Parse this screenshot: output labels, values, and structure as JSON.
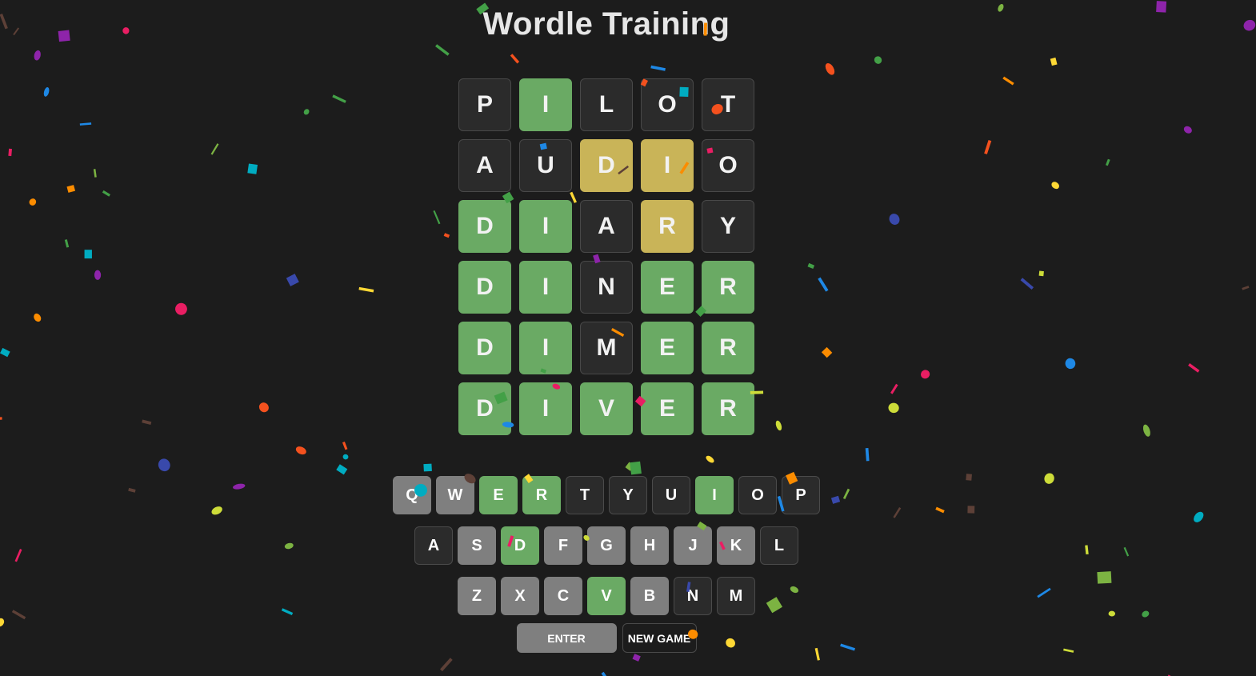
{
  "app": {
    "title": "Wordle Training"
  },
  "colors": {
    "background": "#1c1c1c",
    "correct": "#6aaa64",
    "present": "#c9b458",
    "absent_tile": "#2b2b2b",
    "used_key": "#7f7f7f",
    "unused_key": "#2b2b2b"
  },
  "board": {
    "rows": [
      {
        "letters": [
          "P",
          "I",
          "L",
          "O",
          "T"
        ],
        "states": [
          "absent",
          "correct",
          "absent",
          "absent",
          "absent"
        ]
      },
      {
        "letters": [
          "A",
          "U",
          "D",
          "I",
          "O"
        ],
        "states": [
          "absent",
          "absent",
          "present",
          "present",
          "absent"
        ]
      },
      {
        "letters": [
          "D",
          "I",
          "A",
          "R",
          "Y"
        ],
        "states": [
          "correct",
          "correct",
          "absent",
          "present",
          "absent"
        ]
      },
      {
        "letters": [
          "D",
          "I",
          "N",
          "E",
          "R"
        ],
        "states": [
          "correct",
          "correct",
          "absent",
          "correct",
          "correct"
        ]
      },
      {
        "letters": [
          "D",
          "I",
          "M",
          "E",
          "R"
        ],
        "states": [
          "correct",
          "correct",
          "absent",
          "correct",
          "correct"
        ]
      },
      {
        "letters": [
          "D",
          "I",
          "V",
          "E",
          "R"
        ],
        "states": [
          "correct",
          "correct",
          "correct",
          "correct",
          "correct"
        ]
      }
    ]
  },
  "keyboard": {
    "rows": [
      [
        {
          "key": "Q",
          "state": "used"
        },
        {
          "key": "W",
          "state": "used"
        },
        {
          "key": "E",
          "state": "correct"
        },
        {
          "key": "R",
          "state": "correct"
        },
        {
          "key": "T",
          "state": "unused"
        },
        {
          "key": "Y",
          "state": "unused"
        },
        {
          "key": "U",
          "state": "unused"
        },
        {
          "key": "I",
          "state": "correct"
        },
        {
          "key": "O",
          "state": "unused"
        },
        {
          "key": "P",
          "state": "unused"
        }
      ],
      [
        {
          "key": "A",
          "state": "unused"
        },
        {
          "key": "S",
          "state": "used"
        },
        {
          "key": "D",
          "state": "correct"
        },
        {
          "key": "F",
          "state": "used"
        },
        {
          "key": "G",
          "state": "used"
        },
        {
          "key": "H",
          "state": "used"
        },
        {
          "key": "J",
          "state": "used"
        },
        {
          "key": "K",
          "state": "used"
        },
        {
          "key": "L",
          "state": "unused"
        }
      ],
      [
        {
          "key": "Z",
          "state": "used"
        },
        {
          "key": "X",
          "state": "used"
        },
        {
          "key": "C",
          "state": "used"
        },
        {
          "key": "V",
          "state": "correct"
        },
        {
          "key": "B",
          "state": "used"
        },
        {
          "key": "N",
          "state": "unused"
        },
        {
          "key": "M",
          "state": "unused"
        }
      ]
    ]
  },
  "actions": {
    "enter_label": "ENTER",
    "new_game_label": "NEW GAME"
  },
  "confetti": {
    "palette": [
      "#1e88e5",
      "#8e24aa",
      "#f4511e",
      "#fdd835",
      "#43a047",
      "#00acc1",
      "#fb8c00",
      "#e91e63",
      "#5d4037",
      "#cddc39",
      "#3949ab",
      "#7cb342"
    ]
  }
}
